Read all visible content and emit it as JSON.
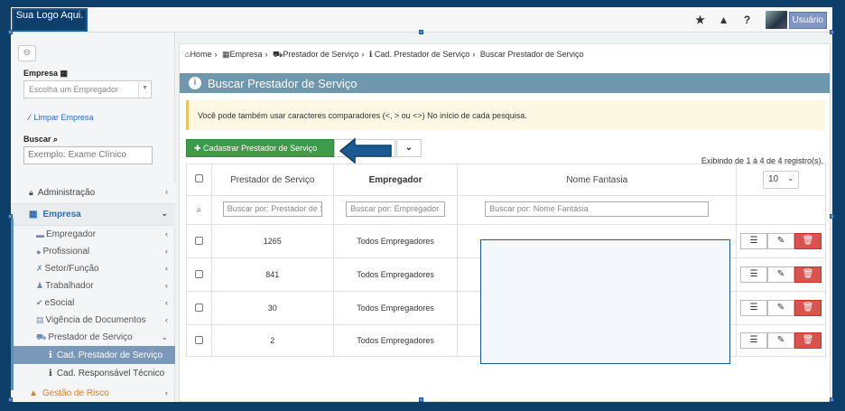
{
  "topbar": {
    "logo_text": "Sua Logo Aqui.",
    "icons": [
      "star-icon",
      "warning-icon",
      "help-icon"
    ],
    "user_label": "Usuário"
  },
  "sidebar": {
    "empresa_label": "Empresa",
    "empresa_placeholder": "Escolha um Empregador",
    "limpar_label": "Limpar Empresa",
    "buscar_label": "Buscar",
    "buscar_placeholder": "Exemplo: Exame Clínico",
    "admin_label": "Administração",
    "empresa_menu_label": "Empresa",
    "sub_items": [
      {
        "label": "Empregador",
        "icon": "building-icon"
      },
      {
        "label": "Profissional",
        "icon": "user-icon"
      },
      {
        "label": "Setor/Função",
        "icon": "wrench-icon"
      },
      {
        "label": "Trabalhador",
        "icon": "person-icon"
      },
      {
        "label": "eSocial",
        "icon": "check-icon"
      },
      {
        "label": "Vigência de Documentos",
        "icon": "calendar-icon"
      },
      {
        "label": "Prestador de Serviço",
        "icon": "car-icon"
      }
    ],
    "leaf_items": [
      {
        "label": "Cad. Prestador de Serviço",
        "active": true
      },
      {
        "label": "Cad. Responsável Técnico",
        "active": false
      }
    ],
    "risco_label": "Gestão de Risco"
  },
  "breadcrumb": {
    "home": "Home",
    "empresa": "Empresa",
    "prestador": "Prestador de Serviço",
    "cad": "Cad. Prestador de Serviço",
    "current": "Buscar Prestador de Serviço"
  },
  "header": {
    "title": "Buscar Prestador de Serviço"
  },
  "alert": {
    "text": "Você pode também usar caracteres comparadores (<, > ou <>) No início de cada pesquisa."
  },
  "toolbar": {
    "add_label": "Cadastrar Prestador de Serviço"
  },
  "records_info": "Exibindo de 1 à 4 de 4 registro(s).",
  "page_length": "10",
  "table": {
    "headers": [
      "Prestador de Serviço",
      "Empregador",
      "Nome Fantasia"
    ],
    "filter_placeholders": [
      "Buscar por: Prestador de Serviço",
      "Buscar por: Empregador",
      "Buscar por: Nome Fantasia"
    ],
    "rows": [
      {
        "prestador": "1265",
        "empregador": "Todos Empregadores"
      },
      {
        "prestador": "841",
        "empregador": "Todos Empregadores"
      },
      {
        "prestador": "30",
        "empregador": "Todos Empregadores"
      },
      {
        "prestador": "2",
        "empregador": "Todos Empregadores"
      }
    ]
  },
  "colors": {
    "accent": "#0e3f6b",
    "header": "#6f97ad",
    "green": "#3f9a4a",
    "danger": "#d9534f"
  }
}
